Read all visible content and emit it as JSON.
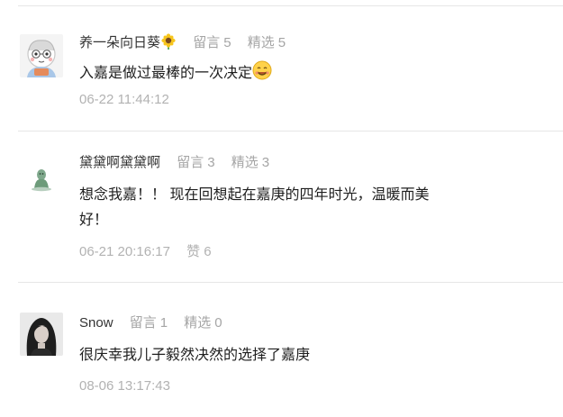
{
  "comments": [
    {
      "name": "养一朵向日葵",
      "name_icon": "sunflower-icon",
      "reply_label": "留言",
      "reply_count": "5",
      "pick_label": "精选",
      "pick_count": "5",
      "content": "入嘉是做过最棒的一次决定",
      "content_icon": "smile-emoji-icon",
      "time": "06-22 11:44:12",
      "avatar": "cartoon-avatar"
    },
    {
      "name": "黛黛啊黛黛啊",
      "reply_label": "留言",
      "reply_count": "3",
      "pick_label": "精选",
      "pick_count": "3",
      "content_line1": "想念我嘉！！ 现在回想起在嘉庚的四年时光，温暖而美",
      "content_line2": "好！",
      "time": "06-21 20:16:17",
      "like_label": "赞",
      "like_count": "6",
      "avatar": "green-figure-avatar"
    },
    {
      "name": "Snow",
      "reply_label": "留言",
      "reply_count": "1",
      "pick_label": "精选",
      "pick_count": "0",
      "content": "很庆幸我儿子毅然决然的选择了嘉庚",
      "time": "08-06 13:17:43",
      "avatar": "portrait-photo-avatar"
    }
  ],
  "colors": {
    "divider": "#e6e6e6",
    "meta_gray": "#a5a5a5",
    "time_gray": "#b2b2b2",
    "name": "#333333"
  }
}
